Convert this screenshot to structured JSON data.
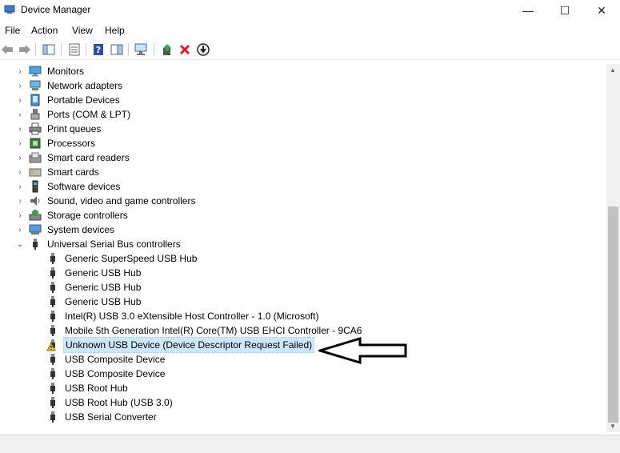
{
  "window": {
    "title": "Device Manager",
    "minimize": "—",
    "maximize": "☐",
    "close": "✕"
  },
  "menu": [
    "File",
    "Action",
    "View",
    "Help"
  ],
  "colors": {
    "selection": "#cce8ff",
    "warning": "#f4c430",
    "error": "#e81123"
  },
  "categories": [
    {
      "label": "Monitors",
      "icon": "monitor-icon"
    },
    {
      "label": "Network adapters",
      "icon": "network-icon"
    },
    {
      "label": "Portable Devices",
      "icon": "portable-icon"
    },
    {
      "label": "Ports (COM & LPT)",
      "icon": "port-icon"
    },
    {
      "label": "Print queues",
      "icon": "printer-icon"
    },
    {
      "label": "Processors",
      "icon": "processor-icon"
    },
    {
      "label": "Smart card readers",
      "icon": "card-reader-icon"
    },
    {
      "label": "Smart cards",
      "icon": "smart-card-icon"
    },
    {
      "label": "Software devices",
      "icon": "software-icon"
    },
    {
      "label": "Sound, video and game controllers",
      "icon": "sound-icon"
    },
    {
      "label": "Storage controllers",
      "icon": "storage-icon"
    },
    {
      "label": "System devices",
      "icon": "system-icon"
    },
    {
      "label": "Universal Serial Bus controllers",
      "icon": "usb-icon"
    }
  ],
  "usb_children": [
    "Generic SuperSpeed USB Hub",
    "Generic USB Hub",
    "Generic USB Hub",
    "Generic USB Hub",
    "Intel(R) USB 3.0 eXtensible Host Controller - 1.0 (Microsoft)",
    "Mobile 5th Generation Intel(R) Core(TM) USB EHCI Controller - 9CA6",
    "Unknown USB Device (Device Descriptor Request Failed)",
    "USB Composite Device",
    "USB Composite Device",
    "USB Root Hub",
    "USB Root Hub (USB 3.0)",
    "USB Serial Converter"
  ]
}
